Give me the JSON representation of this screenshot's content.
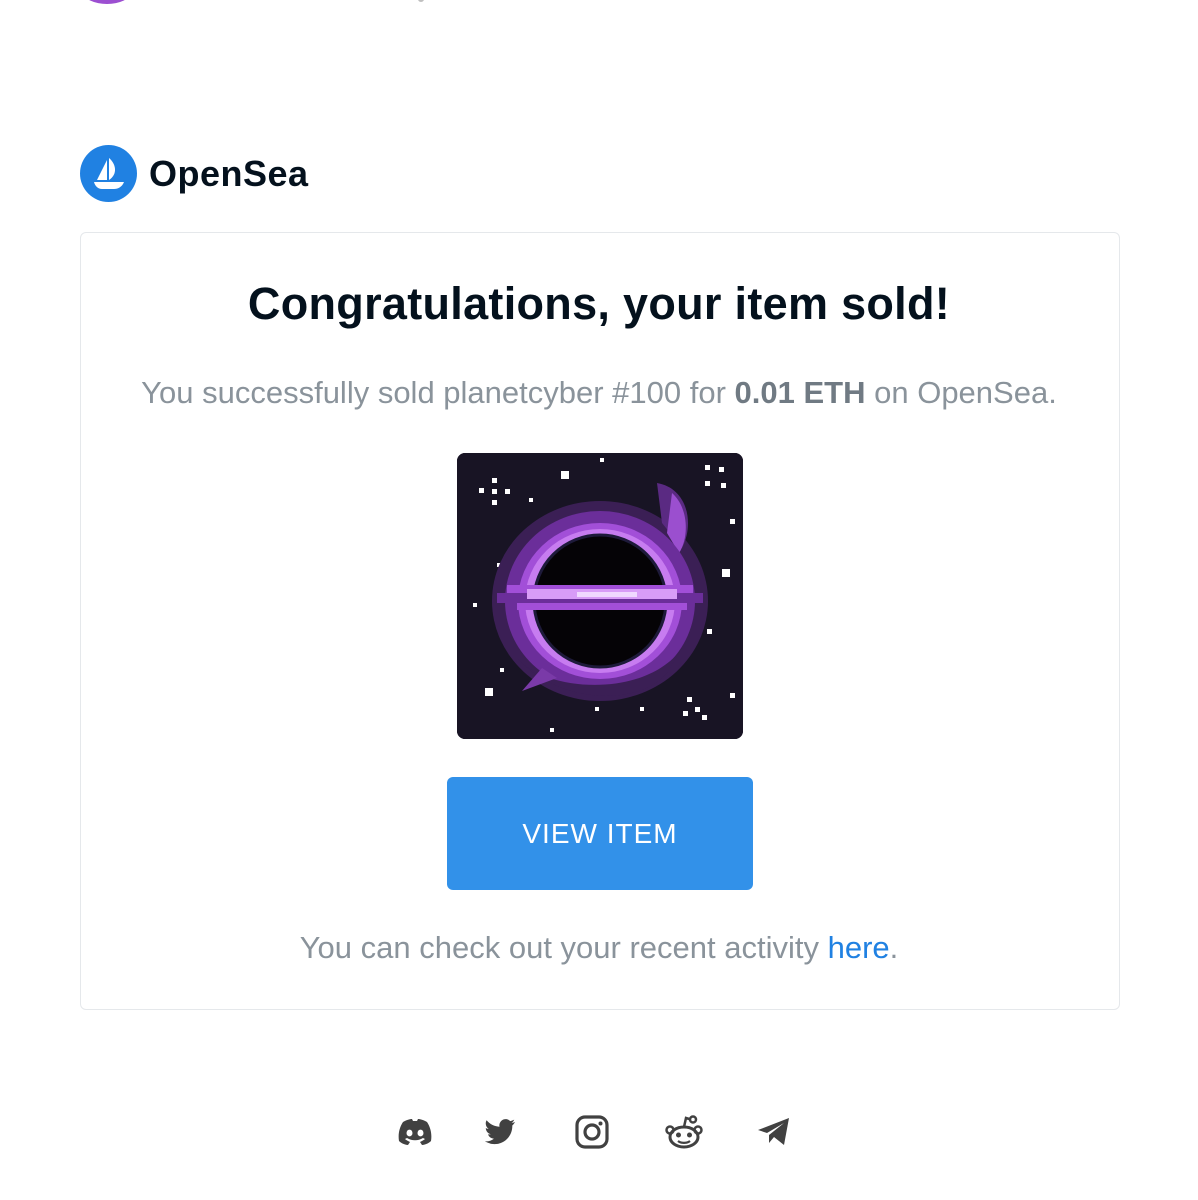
{
  "brand": {
    "name": "OpenSea",
    "accent": "#2081e2",
    "text_color": "#04111d"
  },
  "email": {
    "headline": "Congratulations, your item sold!",
    "summary": {
      "prefix": "You successfully sold planetcyber #100 for ",
      "price": "0.01 ETH",
      "suffix": " on OpenSea."
    },
    "item_image": {
      "description_icon": "black-hole-nft-image"
    },
    "cta_button": {
      "label": "VIEW ITEM",
      "color": "#3291e9"
    },
    "activity": {
      "prefix": "You can check out your recent activity ",
      "link": "here",
      "suffix": "."
    }
  },
  "footer": {
    "social_icons": [
      "discord-icon",
      "twitter-icon",
      "instagram-icon",
      "reddit-icon",
      "telegram-icon"
    ]
  }
}
